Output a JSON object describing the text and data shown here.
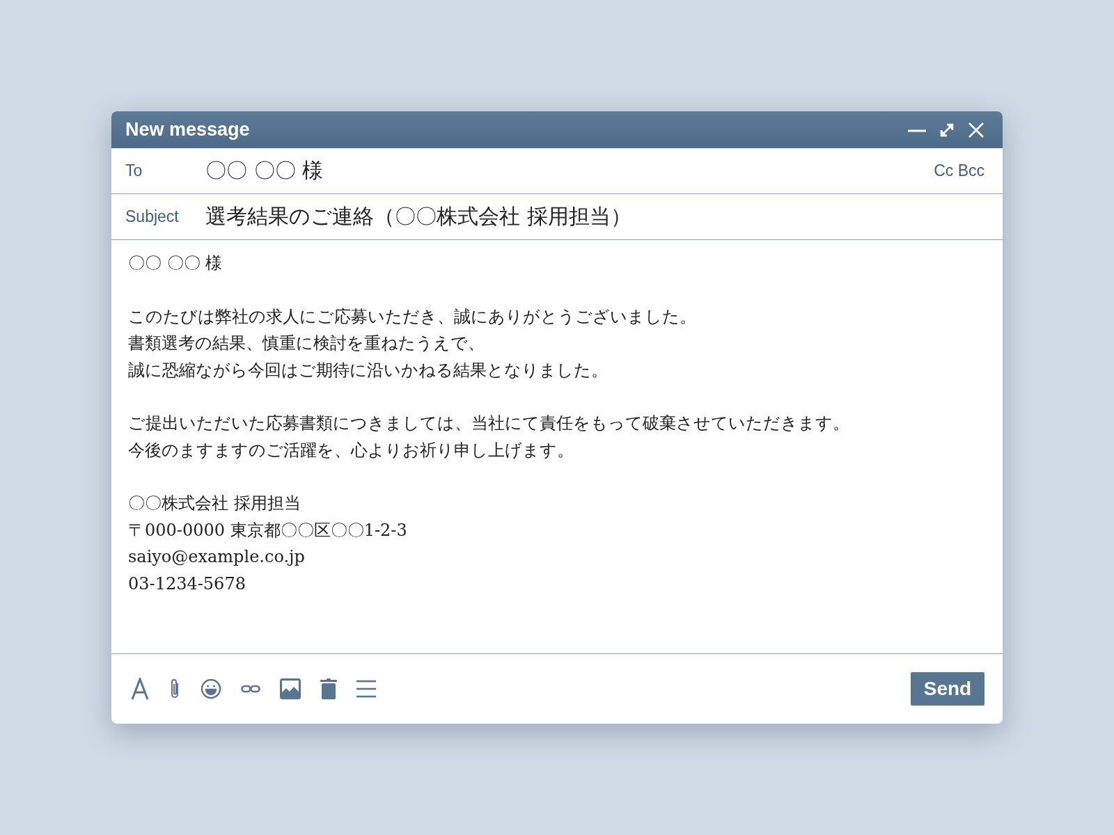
{
  "window": {
    "title": "New message"
  },
  "to": {
    "label": "To",
    "value": "〇〇 〇〇 様",
    "cc_bcc": "Cc Bcc"
  },
  "subject": {
    "label": "Subject",
    "value": "選考結果のご連絡（〇〇株式会社 採用担当）"
  },
  "body": [
    [
      "〇〇 〇〇 様"
    ],
    [
      "このたびは弊社の求人にご応募いただき、誠にありがとうございました。",
      "書類選考の結果、慎重に検討を重ねたうえで、",
      "誠に恐縮ながら今回はご期待に沿いかねる結果となりました。"
    ],
    [
      "ご提出いただいた応募書類につきましては、当社にて責任をもって破棄させていただきます。",
      "今後のますますのご活躍を、心よりお祈り申し上げます。"
    ],
    [
      "〇〇株式会社 採用担当",
      "〒000-0000 東京都〇〇区〇〇1-2-3",
      "saiyo@example.co.jp",
      "03-1234-5678"
    ]
  ],
  "send_button": "Send"
}
